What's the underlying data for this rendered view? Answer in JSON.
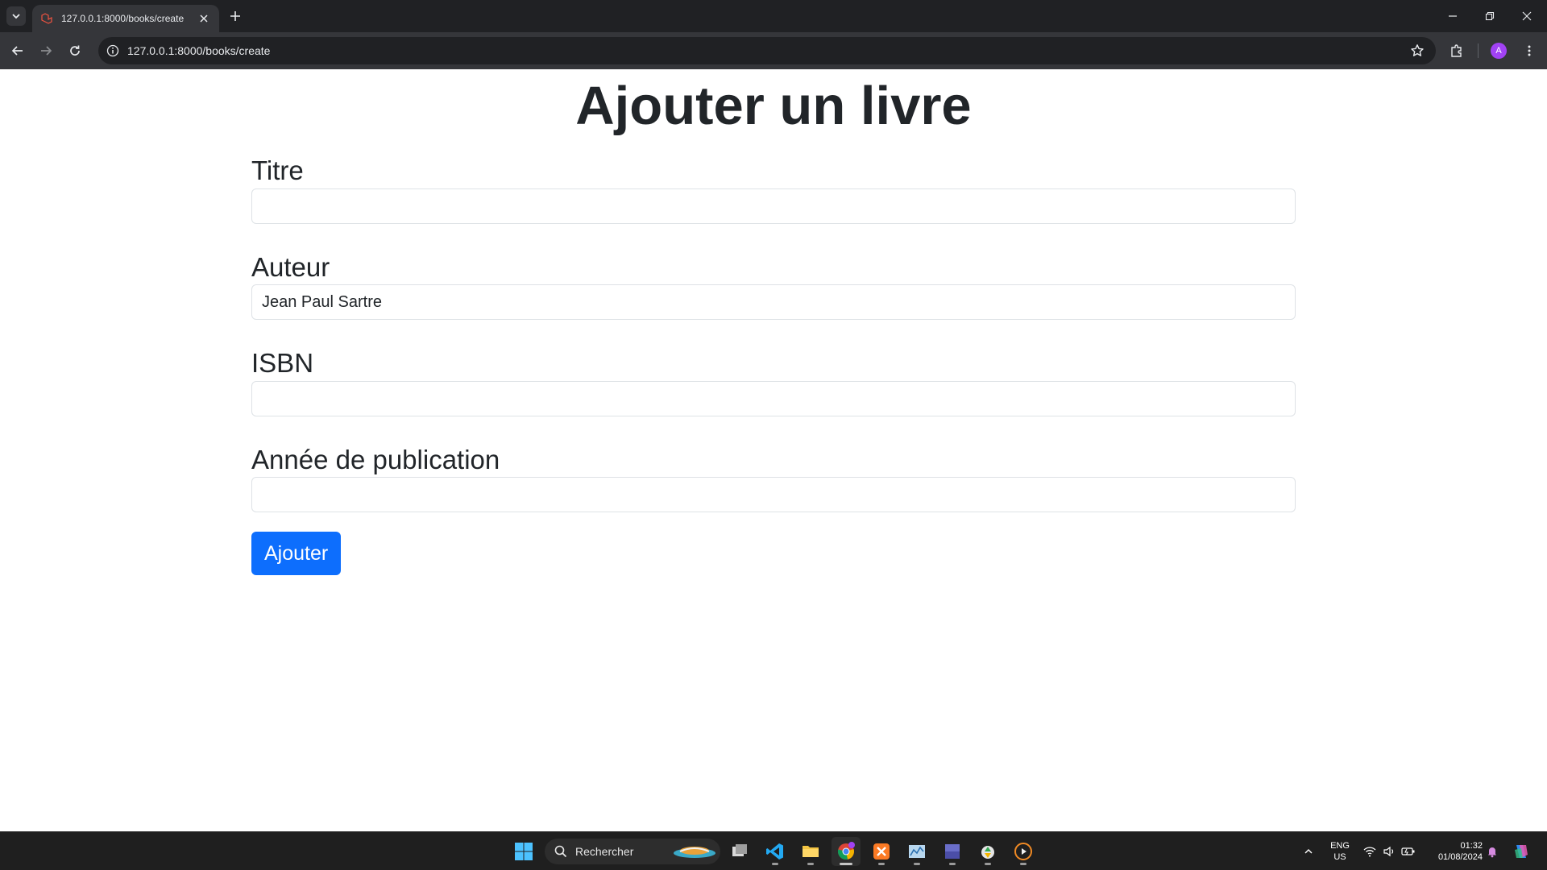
{
  "browser": {
    "tab_title": "127.0.0.1:8000/books/create",
    "url": "127.0.0.1:8000/books/create",
    "profile_initial": "A"
  },
  "page": {
    "title": "Ajouter un livre",
    "fields": [
      {
        "label": "Titre",
        "value": ""
      },
      {
        "label": "Auteur",
        "value": "Jean Paul Sartre"
      },
      {
        "label": "ISBN",
        "value": ""
      },
      {
        "label": "Année de publication",
        "value": ""
      }
    ],
    "submit_label": "Ajouter"
  },
  "taskbar": {
    "search_placeholder": "Rechercher",
    "language": "ENG",
    "region": "US",
    "time": "01:32",
    "date": "01/08/2024"
  },
  "colors": {
    "primary_button": "#0d6efd",
    "text": "#212529",
    "chrome_dark": "#202124",
    "chrome_toolbar": "#35363a"
  }
}
